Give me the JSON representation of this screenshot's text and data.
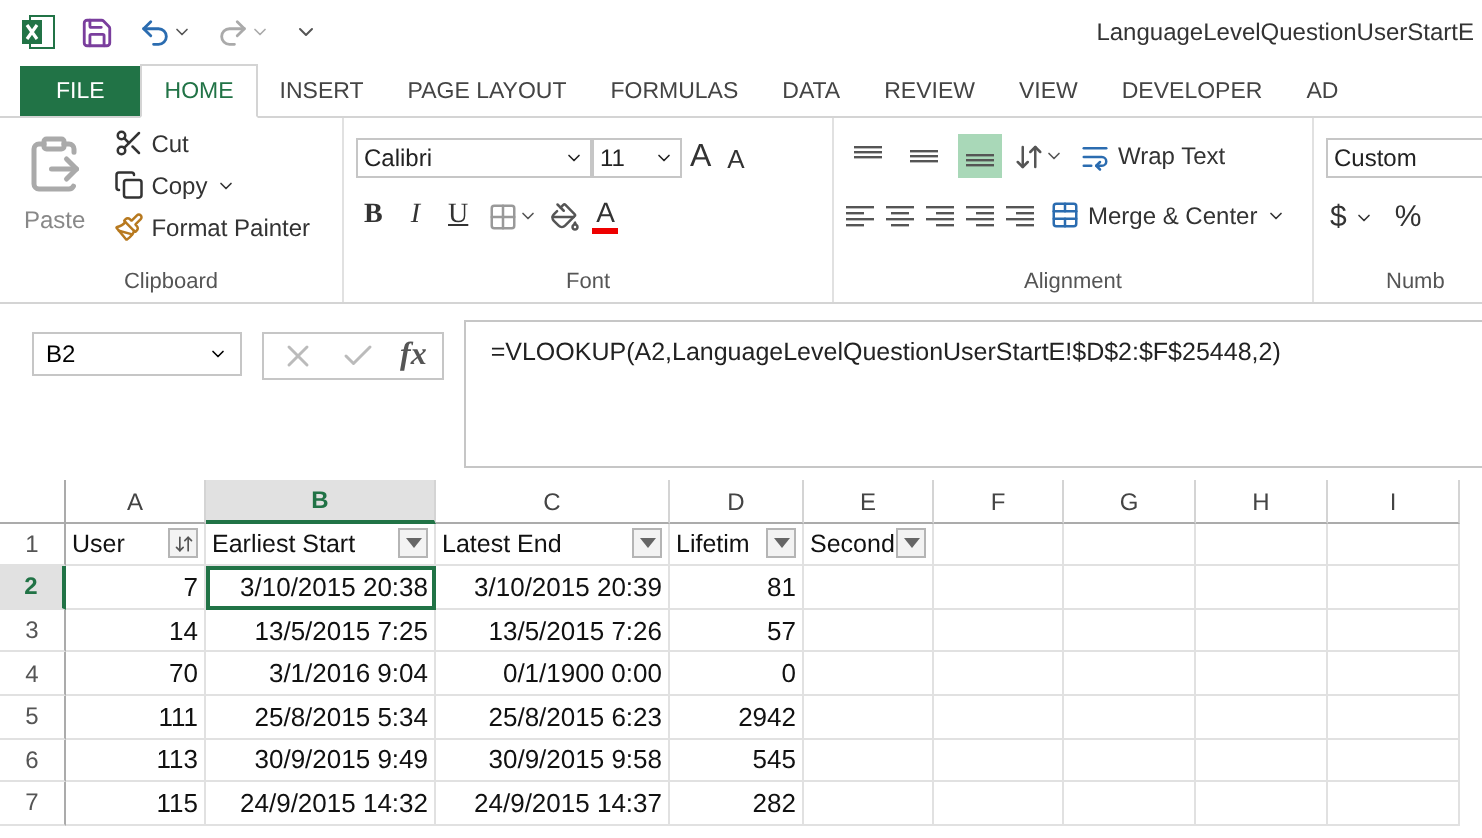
{
  "title_bar": {
    "title": "LanguageLevelQuestionUserStartE"
  },
  "tabs": [
    {
      "label": "FILE",
      "kind": "file",
      "selected": false
    },
    {
      "label": "HOME",
      "kind": "tab",
      "selected": true
    },
    {
      "label": "INSERT",
      "kind": "tab",
      "selected": false
    },
    {
      "label": "PAGE LAYOUT",
      "kind": "tab",
      "selected": false
    },
    {
      "label": "FORMULAS",
      "kind": "tab",
      "selected": false
    },
    {
      "label": "DATA",
      "kind": "tab",
      "selected": false
    },
    {
      "label": "REVIEW",
      "kind": "tab",
      "selected": false
    },
    {
      "label": "VIEW",
      "kind": "tab",
      "selected": false
    },
    {
      "label": "DEVELOPER",
      "kind": "tab",
      "selected": false
    },
    {
      "label": "AD",
      "kind": "tab",
      "selected": false
    }
  ],
  "clipboard": {
    "paste": "Paste",
    "cut": "Cut",
    "copy": "Copy",
    "format_painter": "Format Painter",
    "label": "Clipboard"
  },
  "font": {
    "font_name": "Calibri",
    "font_size": "11",
    "grow": "A",
    "shrink": "A",
    "bold": "B",
    "italic": "I",
    "underline": "U",
    "font_color": "A",
    "label": "Font"
  },
  "alignment": {
    "bottom_align_selected": true,
    "wrap_text": "Wrap Text",
    "merge": "Merge & Center",
    "label": "Alignment"
  },
  "number": {
    "format": "Custom",
    "currency": "$",
    "percent": "%",
    "label": "Numb"
  },
  "formula_bar": {
    "name_box": "B2",
    "fx": "fx",
    "formula": "=VLOOKUP(A2,LanguageLevelQuestionUserStartE!$D$2:$F$25448,2)"
  },
  "columns": [
    {
      "label": "A",
      "selected": false
    },
    {
      "label": "B",
      "selected": true
    },
    {
      "label": "C",
      "selected": false
    },
    {
      "label": "D",
      "selected": false
    },
    {
      "label": "E",
      "selected": false
    },
    {
      "label": "F",
      "selected": false
    },
    {
      "label": "G",
      "selected": false
    },
    {
      "label": "H",
      "selected": false
    },
    {
      "label": "I",
      "selected": false
    }
  ],
  "header_row": {
    "number": "1",
    "cells": [
      {
        "text": "User",
        "sorted": true
      },
      {
        "text": "Earliest Start",
        "sorted": false
      },
      {
        "text": "Latest End",
        "sorted": false
      },
      {
        "text": "Lifetim",
        "sorted": false
      },
      {
        "text": "Second",
        "sorted": false
      }
    ]
  },
  "rows": [
    {
      "number": "2",
      "selected": true,
      "cells": [
        "7",
        "3/10/2015 20:38",
        "3/10/2015 20:39",
        "81"
      ]
    },
    {
      "number": "3",
      "selected": false,
      "cells": [
        "14",
        "13/5/2015 7:25",
        "13/5/2015 7:26",
        "57"
      ]
    },
    {
      "number": "4",
      "selected": false,
      "cells": [
        "70",
        "3/1/2016 9:04",
        "0/1/1900 0:00",
        "0"
      ]
    },
    {
      "number": "5",
      "selected": false,
      "cells": [
        "111",
        "25/8/2015 5:34",
        "25/8/2015 6:23",
        "2942"
      ]
    },
    {
      "number": "6",
      "selected": false,
      "cells": [
        "113",
        "30/9/2015 9:49",
        "30/9/2015 9:58",
        "545"
      ]
    },
    {
      "number": "7",
      "selected": false,
      "cells": [
        "115",
        "24/9/2015 14:32",
        "24/9/2015 14:37",
        "282"
      ]
    }
  ]
}
